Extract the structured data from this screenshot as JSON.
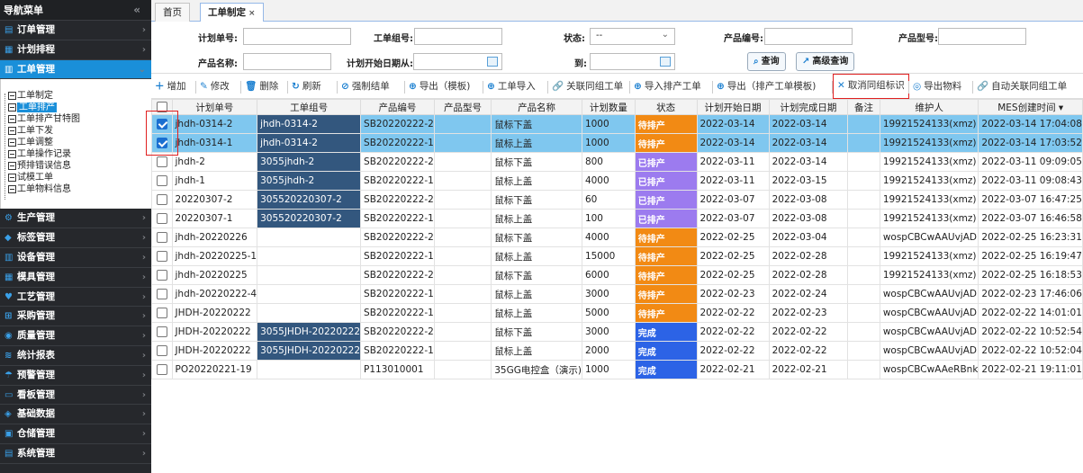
{
  "sidebar": {
    "title": "导航菜单",
    "collapse_icon": "«",
    "menus_top": [
      {
        "label": "订单管理",
        "icon": "order-icon"
      },
      {
        "label": "计划排程",
        "icon": "schedule-icon"
      },
      {
        "label": "工单管理",
        "icon": "workorder-icon",
        "active": true
      }
    ],
    "submenu": [
      "工单制定",
      "工单排产",
      "工单排产甘特图",
      "工单下发",
      "工单调整",
      "工单操作记录",
      "预排错误信息",
      "试模工单",
      "工单物料信息"
    ],
    "submenu_active": "工单排产",
    "menus_bottom": [
      "生产管理",
      "标签管理",
      "设备管理",
      "模具管理",
      "工艺管理",
      "采购管理",
      "质量管理",
      "统计报表",
      "预警管理",
      "看板管理",
      "基础数据",
      "仓储管理",
      "系统管理"
    ]
  },
  "tabs": {
    "home": "首页",
    "current": "工单制定",
    "close": "×"
  },
  "search": {
    "plan_no_label": "计划单号:",
    "group_no_label": "工单组号:",
    "status_label": "状态:",
    "status_value": "--",
    "product_code_label": "产品编号:",
    "product_model_label": "产品型号:",
    "product_name_label": "产品名称:",
    "start_date_label": "计划开始日期从:",
    "to_label": "到:",
    "query_button": "查询",
    "advanced_button": "高级查询"
  },
  "toolbar": [
    "增加",
    "修改",
    "删除",
    "刷新",
    "强制结单",
    "导出（模板)",
    "工单导入",
    "关联同组工单",
    "导入排产工单",
    "导出（排产工单模板)",
    "取消同组标识",
    "导出物料",
    "自动关联同组工单"
  ],
  "table": {
    "columns": [
      "计划单号",
      "工单组号",
      "产品编号",
      "产品型号",
      "产品名称",
      "计划数量",
      "状态",
      "计划开始日期",
      "计划完成日期",
      "备注",
      "维护人",
      "MES创建时间 ▾"
    ],
    "rows": [
      {
        "checked": true,
        "plan": "jhdh-0314-2",
        "group": "jhdh-0314-2",
        "code": "SB20220222-2",
        "model": "",
        "name": "鼠标下盖",
        "qty": "1000",
        "status": "待排产",
        "start": "2022-03-14",
        "end": "2022-03-14",
        "note": "",
        "user": "19921524133(xmz)",
        "created": "2022-03-14 17:04:08"
      },
      {
        "checked": true,
        "plan": "jhdh-0314-1",
        "group": "jhdh-0314-2",
        "code": "SB20220222-1",
        "model": "",
        "name": "鼠标上盖",
        "qty": "1000",
        "status": "待排产",
        "start": "2022-03-14",
        "end": "2022-03-14",
        "note": "",
        "user": "19921524133(xmz)",
        "created": "2022-03-14 17:03:52"
      },
      {
        "checked": false,
        "plan": "jhdh-2",
        "group": "3055jhdh-2",
        "code": "SB20220222-2",
        "model": "",
        "name": "鼠标下盖",
        "qty": "800",
        "status": "已排产",
        "start": "2022-03-11",
        "end": "2022-03-14",
        "note": "",
        "user": "19921524133(xmz)",
        "created": "2022-03-11 09:09:05"
      },
      {
        "checked": false,
        "plan": "jhdh-1",
        "group": "3055jhdh-2",
        "code": "SB20220222-1",
        "model": "",
        "name": "鼠标上盖",
        "qty": "4000",
        "status": "已排产",
        "start": "2022-03-11",
        "end": "2022-03-15",
        "note": "",
        "user": "19921524133(xmz)",
        "created": "2022-03-11 09:08:43"
      },
      {
        "checked": false,
        "plan": "20220307-2",
        "group": "305520220307-2",
        "code": "SB20220222-2",
        "model": "",
        "name": "鼠标下盖",
        "qty": "60",
        "status": "已排产",
        "start": "2022-03-07",
        "end": "2022-03-08",
        "note": "",
        "user": "19921524133(xmz)",
        "created": "2022-03-07 16:47:25"
      },
      {
        "checked": false,
        "plan": "20220307-1",
        "group": "305520220307-2",
        "code": "SB20220222-1",
        "model": "",
        "name": "鼠标上盖",
        "qty": "100",
        "status": "已排产",
        "start": "2022-03-07",
        "end": "2022-03-08",
        "note": "",
        "user": "19921524133(xmz)",
        "created": "2022-03-07 16:46:58"
      },
      {
        "checked": false,
        "plan": "jhdh-20220226",
        "group": "",
        "code": "SB20220222-2",
        "model": "",
        "name": "鼠标下盖",
        "qty": "4000",
        "status": "待排产",
        "start": "2022-02-25",
        "end": "2022-03-04",
        "note": "",
        "user": "wospCBCwAAUvjAD",
        "created": "2022-02-25 16:23:31"
      },
      {
        "checked": false,
        "plan": "jhdh-20220225-1",
        "group": "",
        "code": "SB20220222-1",
        "model": "",
        "name": "鼠标上盖",
        "qty": "15000",
        "status": "待排产",
        "start": "2022-02-25",
        "end": "2022-02-28",
        "note": "",
        "user": "19921524133(xmz)",
        "created": "2022-02-25 16:19:47"
      },
      {
        "checked": false,
        "plan": "jhdh-20220225",
        "group": "",
        "code": "SB20220222-2",
        "model": "",
        "name": "鼠标下盖",
        "qty": "6000",
        "status": "待排产",
        "start": "2022-02-25",
        "end": "2022-02-28",
        "note": "",
        "user": "19921524133(xmz)",
        "created": "2022-02-25 16:18:53"
      },
      {
        "checked": false,
        "plan": "jhdh-20220222-4",
        "group": "",
        "code": "SB20220222-1",
        "model": "",
        "name": "鼠标上盖",
        "qty": "3000",
        "status": "待排产",
        "start": "2022-02-23",
        "end": "2022-02-24",
        "note": "",
        "user": "wospCBCwAAUvjAD",
        "created": "2022-02-23 17:46:06"
      },
      {
        "checked": false,
        "plan": "JHDH-20220222",
        "group": "",
        "code": "SB20220222-1",
        "model": "",
        "name": "鼠标上盖",
        "qty": "5000",
        "status": "待排产",
        "start": "2022-02-22",
        "end": "2022-02-23",
        "note": "",
        "user": "wospCBCwAAUvjAD",
        "created": "2022-02-22 14:01:01"
      },
      {
        "checked": false,
        "plan": "JHDH-20220222",
        "group": "3055JHDH-20220222",
        "code": "SB20220222-2",
        "model": "",
        "name": "鼠标下盖",
        "qty": "3000",
        "status": "完成",
        "start": "2022-02-22",
        "end": "2022-02-22",
        "note": "",
        "user": "wospCBCwAAUvjAD",
        "created": "2022-02-22 10:52:54"
      },
      {
        "checked": false,
        "plan": "JHDH-20220222",
        "group": "3055JHDH-20220222",
        "code": "SB20220222-1",
        "model": "",
        "name": "鼠标上盖",
        "qty": "2000",
        "status": "完成",
        "start": "2022-02-22",
        "end": "2022-02-22",
        "note": "",
        "user": "wospCBCwAAUvjAD",
        "created": "2022-02-22 10:52:04"
      },
      {
        "checked": false,
        "plan": "PO20220221-19",
        "group": "",
        "code": "P113010001",
        "model": "",
        "name": "35GG电控盒（演示)",
        "qty": "1000",
        "status": "完成",
        "start": "2022-02-21",
        "end": "2022-02-21",
        "note": "",
        "user": "wospCBCwAAeRBnk",
        "created": "2022-02-21 19:11:01"
      }
    ]
  },
  "colors": {
    "待排产": "#f28a14",
    "已排产": "#9c7bef",
    "完成": "#2c63e6",
    "accent": "#1a8fd9",
    "checked_row": "#7fc7ef",
    "group_cell": "#33577e"
  }
}
